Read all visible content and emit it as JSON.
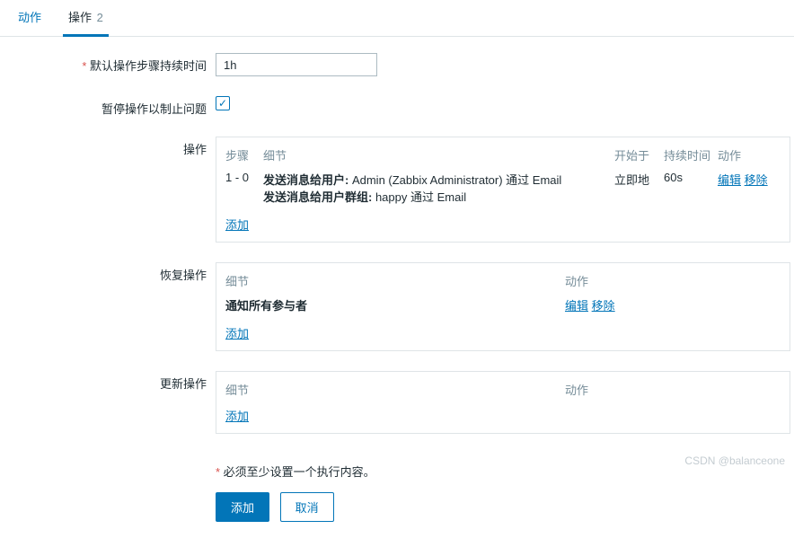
{
  "tabs": {
    "action": "动作",
    "operations": "操作",
    "operations_count": "2"
  },
  "fields": {
    "default_step_duration_label": "默认操作步骤持续时间",
    "default_step_duration_value": "1h",
    "pause_label": "暂停操作以制止问题",
    "operation_label": "操作",
    "recovery_label": "恢复操作",
    "update_label": "更新操作"
  },
  "headers": {
    "steps": "步骤",
    "details": "细节",
    "start_in": "开始于",
    "duration": "持续时间",
    "action": "动作"
  },
  "operations": {
    "row_steps": "1 - 0",
    "detail1_label": "发送消息给用户:",
    "detail1_rest": " Admin (Zabbix Administrator) 通过 Email",
    "detail2_label": "发送消息给用户群组:",
    "detail2_rest": " happy 通过 Email",
    "start_in": "立即地",
    "duration": "60s"
  },
  "recovery": {
    "detail_text": "通知所有参与者"
  },
  "links": {
    "edit": "编辑",
    "remove": "移除",
    "add": "添加"
  },
  "footer": {
    "note": "必须至少设置一个执行内容。",
    "submit": "添加",
    "cancel": "取消"
  },
  "watermark": "CSDN @balanceone"
}
